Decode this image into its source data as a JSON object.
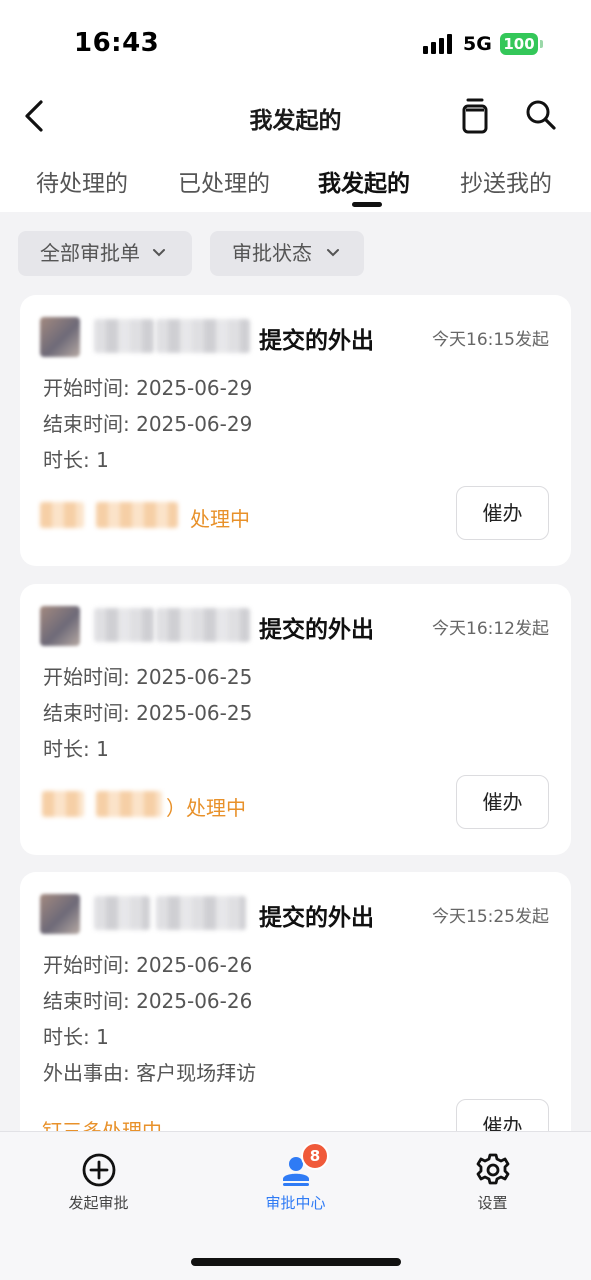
{
  "status_bar": {
    "time": "16:43",
    "network": "5G",
    "battery": "100"
  },
  "nav": {
    "title": "我发起的",
    "back_icon": "chevron-left-icon",
    "clipboard_icon": "clipboard-icon",
    "search_icon": "search-icon"
  },
  "tabs": [
    {
      "label": "待处理的",
      "active": false
    },
    {
      "label": "已处理的",
      "active": false
    },
    {
      "label": "我发起的",
      "active": true
    },
    {
      "label": "抄送我的",
      "active": false
    }
  ],
  "filters": [
    {
      "label": "全部审批单",
      "icon": "chevron-down-icon"
    },
    {
      "label": "审批状态",
      "icon": "chevron-down-icon"
    }
  ],
  "cards": [
    {
      "title": "提交的外出",
      "time": "今天16:15发起",
      "fields": [
        "开始时间: 2025-06-29",
        "结束时间: 2025-06-29",
        "时长: 1"
      ],
      "status": "处理中",
      "action": "催办"
    },
    {
      "title": "提交的外出",
      "time": "今天16:12发起",
      "fields": [
        "开始时间: 2025-06-25",
        "结束时间: 2025-06-25",
        "时长: 1"
      ],
      "status": "）处理中",
      "action": "催办"
    },
    {
      "title": "提交的外出",
      "time": "今天15:25发起",
      "fields": [
        "开始时间: 2025-06-26",
        "结束时间: 2025-06-26",
        "时长: 1",
        "外出事由: 客户现场拜访"
      ],
      "status": "钉三多处理中",
      "action": "催办"
    }
  ],
  "tabbar": [
    {
      "label": "发起审批",
      "icon": "plus-circle-icon"
    },
    {
      "label": "审批中心",
      "icon": "approval-center-icon",
      "badge": "8",
      "active": true
    },
    {
      "label": "设置",
      "icon": "gear-icon"
    }
  ],
  "colors": {
    "accent": "#2f7bf5",
    "status_orange": "#e8912a",
    "badge": "#f05a3a",
    "battery": "#34c759"
  }
}
